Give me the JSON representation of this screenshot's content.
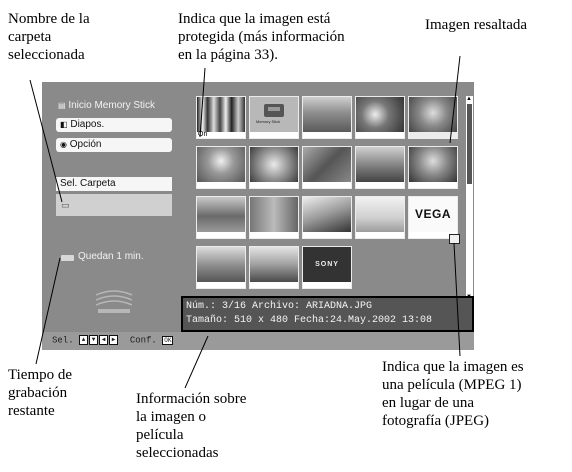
{
  "annotations": {
    "folder_name": "Nombre de la\ncarpeta\nseleccionada",
    "protected": "Indica que la imagen está\nprotegida (más información\nen la página 33).",
    "highlighted": "Imagen resaltada",
    "movie": "Indica que la imagen es\nuna película (MPEG 1)\nen lugar de una\nfotografía (JPEG)",
    "remaining_time": "Tiempo de\ngrabación\nrestante",
    "image_info": "Información sobre\nla imagen o\npelícula\nseleccionadas"
  },
  "screen": {
    "sidebar": {
      "title": "Inicio Memory Stick",
      "buttons": [
        "Diapos.",
        "Opción"
      ],
      "select_folder": "Sel. Carpeta",
      "remaining": "Quedan 1 min."
    },
    "thumbnails": {
      "protected_mark": "On",
      "ms_label": "Memory Stick",
      "vega_logo": "VEGA",
      "sony_logo": "SONY"
    },
    "info": {
      "line1": "Núm.: 3/16        Archivo: ARIADNA.JPG",
      "line2": "Tamaño: 510 x 480 Fecha:24.May.2002 13:08"
    },
    "bottom": {
      "select_label": "Sel.",
      "confirm_label": "Conf.",
      "ok_label": "OK"
    }
  },
  "colors": {
    "screen_bg": "#8a8a8a",
    "info_bg": "#555555"
  }
}
